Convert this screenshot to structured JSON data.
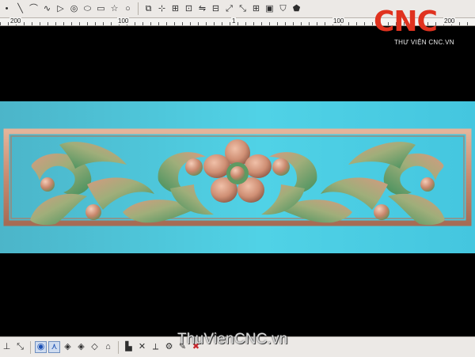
{
  "top_toolbar": {
    "tools": [
      {
        "name": "point-icon",
        "glyph": "•"
      },
      {
        "name": "line-icon",
        "glyph": "╲"
      },
      {
        "name": "arc-icon",
        "glyph": "⌒"
      },
      {
        "name": "spline-icon",
        "glyph": "∿"
      },
      {
        "name": "polyline-icon",
        "glyph": "▷"
      },
      {
        "name": "circle-center-icon",
        "glyph": "◎"
      },
      {
        "name": "ellipse-icon",
        "glyph": "⬭"
      },
      {
        "name": "rectangle-icon",
        "glyph": "▭"
      },
      {
        "name": "star-icon",
        "glyph": "☆"
      },
      {
        "name": "circle-icon",
        "glyph": "○"
      }
    ],
    "edit_tools": [
      {
        "name": "copy-icon",
        "glyph": "⧉"
      },
      {
        "name": "node-edit-icon",
        "glyph": "⊹"
      },
      {
        "name": "trim-icon",
        "glyph": "⊞"
      },
      {
        "name": "offset-icon",
        "glyph": "⊡"
      },
      {
        "name": "mirror-icon",
        "glyph": "⇋"
      },
      {
        "name": "align-icon",
        "glyph": "⊟"
      },
      {
        "name": "scale-icon",
        "glyph": "⤢"
      },
      {
        "name": "transform-icon",
        "glyph": "⤡"
      },
      {
        "name": "grid-icon",
        "glyph": "⊞"
      },
      {
        "name": "layer-icon",
        "glyph": "▣"
      },
      {
        "name": "shield-icon",
        "glyph": "⛉"
      },
      {
        "name": "badge-icon",
        "glyph": "⬟"
      }
    ]
  },
  "ruler": {
    "labels": [
      "200",
      "100",
      "1",
      "100",
      "200"
    ]
  },
  "logo": {
    "text": "CNC",
    "subtitle": "THƯ VIỆN CNC.VN",
    "color": "#e0321f"
  },
  "watermark": {
    "text": "ThuVienCNC.vn"
  },
  "bottom_toolbar": {
    "tools": [
      {
        "name": "axis-icon",
        "glyph": "⊥",
        "style": ""
      },
      {
        "name": "path-icon",
        "glyph": "⤡",
        "style": ""
      },
      {
        "name": "target-icon",
        "glyph": "◉",
        "style": "active blue"
      },
      {
        "name": "node-icon",
        "glyph": "⋏",
        "style": "active blue"
      },
      {
        "name": "diamond-icon",
        "glyph": "◈",
        "style": ""
      },
      {
        "name": "diamond-grid-icon",
        "glyph": "◈",
        "style": ""
      },
      {
        "name": "diamond-small-icon",
        "glyph": "◇",
        "style": ""
      },
      {
        "name": "surface-icon",
        "glyph": "⌂",
        "style": ""
      },
      {
        "name": "chart-icon",
        "glyph": "▙",
        "style": ""
      },
      {
        "name": "tool-cross-icon",
        "glyph": "✕",
        "style": ""
      },
      {
        "name": "axis-3d-icon",
        "glyph": "⟂",
        "style": ""
      },
      {
        "name": "sculpt-icon",
        "glyph": "⚙",
        "style": ""
      },
      {
        "name": "brush-icon",
        "glyph": "✎",
        "style": ""
      },
      {
        "name": "delete-icon",
        "glyph": "✖",
        "style": "red"
      }
    ]
  },
  "colors": {
    "panel_bg": "#45cfe0",
    "frame_copper": "#c98d73",
    "green_accent": "#5ca06b"
  }
}
